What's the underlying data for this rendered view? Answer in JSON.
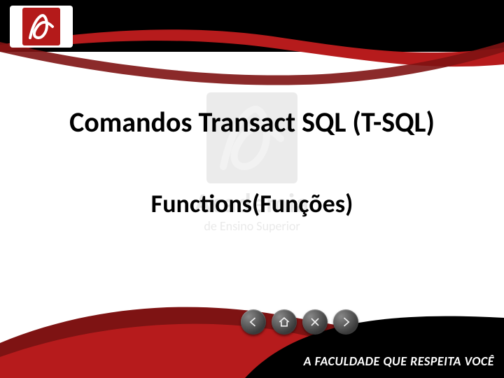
{
  "brand": {
    "name": "Academia",
    "sub": "de Ensino Superior",
    "colors": {
      "red": "#b61b1c",
      "darkred": "#7e1313",
      "black": "#000000"
    }
  },
  "watermark": {
    "line1": "Academia",
    "line2": "de Ensino Superior"
  },
  "content": {
    "title": "Comandos Transact SQL (T-SQL)",
    "subtitle": "Functions(Funções)"
  },
  "nav": {
    "buttons": [
      "back",
      "home",
      "close",
      "forward"
    ]
  },
  "tagline": {
    "line1": "A FACULDADE QUE RESPEITA",
    "line2": "VOCÊ"
  }
}
